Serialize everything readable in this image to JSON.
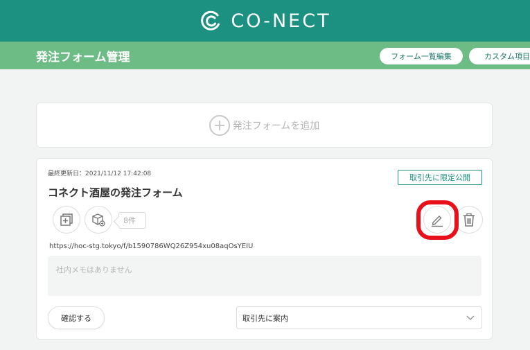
{
  "header": {
    "logo_text": "CO-NECT",
    "logo_icon": "conect-logo-icon",
    "brand_color": "#1c9181"
  },
  "subheader": {
    "title": "発注フォーム管理",
    "buttons": [
      "フォーム一覧編集",
      "カスタム項目"
    ],
    "bar_color": "#6ebc85"
  },
  "add_form": {
    "label": "発注フォームを追加",
    "icon": "plus-circle-icon"
  },
  "form_card": {
    "updated_at": "最終更新日：2021/11/12 17:42:08",
    "scope_badge": "取引先に限定公開",
    "name": "コネクト酒屋の発注フォーム",
    "product_count": "8件",
    "url": "https://hoc-stg.tokyo/f/b1590786WQ26Z954xu08aqOsYEIU",
    "memo_placeholder": "社内メモはありません",
    "confirm_label": "確認する",
    "guide_select": {
      "selected": "取引先に案内"
    },
    "icons": [
      "copy-icon",
      "product-box-icon",
      "edit-pencil-icon",
      "trash-icon"
    ],
    "highlight_color": "#e8101b"
  }
}
